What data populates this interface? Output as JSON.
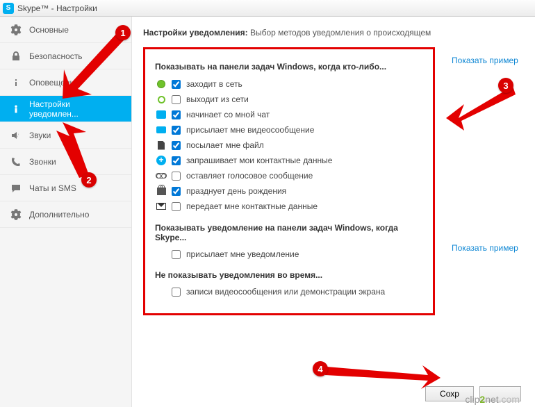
{
  "window_title": "Skype™ - Настройки",
  "sidebar": {
    "items": [
      {
        "label": "Основные"
      },
      {
        "label": "Безопасность"
      },
      {
        "label": "Оповещения"
      },
      {
        "label": "Настройки уведомлен..."
      },
      {
        "label": "Звуки"
      },
      {
        "label": "Звонки"
      },
      {
        "label": "Чаты и SMS"
      },
      {
        "label": "Дополнительно"
      }
    ]
  },
  "header": {
    "bold": "Настройки уведомления:",
    "rest": "Выбор методов уведомления о происходящем"
  },
  "section1_title": "Показывать на панели задач Windows, когда кто-либо...",
  "opts1": [
    {
      "label": "заходит в сеть",
      "checked": true
    },
    {
      "label": "выходит из сети",
      "checked": false
    },
    {
      "label": "начинает со мной чат",
      "checked": true
    },
    {
      "label": "присылает мне видеосообщение",
      "checked": true
    },
    {
      "label": "посылает мне файл",
      "checked": true
    },
    {
      "label": "запрашивает мои контактные данные",
      "checked": true
    },
    {
      "label": "оставляет голосовое сообщение",
      "checked": false
    },
    {
      "label": "празднует день рождения",
      "checked": true
    },
    {
      "label": "передает мне контактные данные",
      "checked": false
    }
  ],
  "section2_title": "Показывать уведомление на панели задач Windows, когда Skype...",
  "opts2": [
    {
      "label": "присылает мне уведомление",
      "checked": false
    }
  ],
  "section3_title": "Не показывать уведомления во время...",
  "opts3": [
    {
      "label": "записи видеосообщения или демонстрации экрана",
      "checked": false
    }
  ],
  "show_example": "Показать пример",
  "buttons": {
    "save": "Сохр"
  },
  "callouts": {
    "c1": "1",
    "c2": "2",
    "c3": "3",
    "c4": "4"
  }
}
